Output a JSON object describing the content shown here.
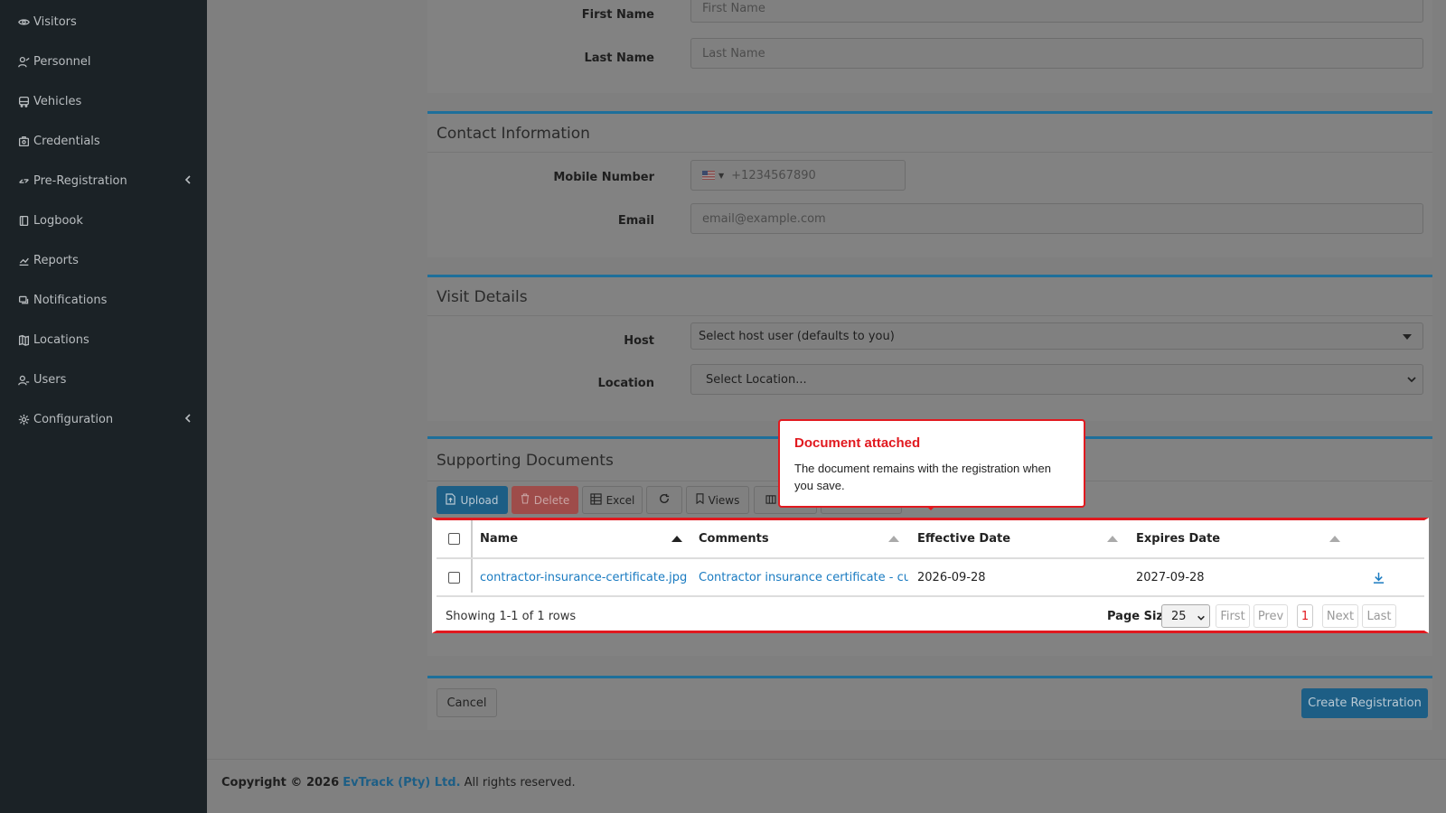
{
  "sidebar": {
    "items": [
      {
        "label": "Visitors",
        "icon": "eye-icon"
      },
      {
        "label": "Personnel",
        "icon": "user-icon"
      },
      {
        "label": "Vehicles",
        "icon": "bus-icon"
      },
      {
        "label": "Credentials",
        "icon": "badge-icon"
      },
      {
        "label": "Pre-Registration",
        "icon": "exchange-icon"
      },
      {
        "label": "Logbook",
        "icon": "book-icon"
      },
      {
        "label": "Reports",
        "icon": "chart-icon"
      },
      {
        "label": "Notifications",
        "icon": "bell-icon"
      },
      {
        "label": "Locations",
        "icon": "map-icon"
      },
      {
        "label": "Users",
        "icon": "users-icon"
      },
      {
        "label": "Configuration",
        "icon": "gear-icon"
      }
    ]
  },
  "personal": {
    "first_name_label": "First Name",
    "first_name_placeholder": "First Name",
    "last_name_label": "Last Name",
    "last_name_placeholder": "Last Name"
  },
  "contact": {
    "heading": "Contact Information",
    "mobile_label": "Mobile Number",
    "mobile_placeholder": "+1234567890",
    "email_label": "Email",
    "email_placeholder": "email@example.com"
  },
  "visit": {
    "heading": "Visit Details",
    "host_label": "Host",
    "host_value": "Select host user (defaults to you)",
    "location_label": "Location",
    "location_value": "Select Location..."
  },
  "documents": {
    "heading": "Supporting Documents",
    "toolbar": {
      "upload": "Upload",
      "delete": "Delete",
      "excel": "Excel",
      "views": "Views"
    },
    "columns": [
      "Name",
      "Comments",
      "Effective Date",
      "Expires Date"
    ],
    "rows": [
      {
        "name": "contractor-insurance-certificate.jpg",
        "comments": "Contractor insurance certificate - cur…",
        "effective": "2026-09-28",
        "expires": "2027-09-28"
      }
    ],
    "summary": "Showing 1-1 of 1 rows",
    "page_size_label": "Page Size",
    "page_size": "25",
    "pager": {
      "first": "First",
      "prev": "Prev",
      "current": "1",
      "next": "Next",
      "last": "Last"
    }
  },
  "popover": {
    "title": "Document attached",
    "body": "The document remains with the registration when you save."
  },
  "actions": {
    "cancel": "Cancel",
    "create": "Create Registration"
  },
  "footer": {
    "prefix": "Copyright © 2026",
    "company": "EvTrack (Pty) Ltd.",
    "suffix": "All rights reserved."
  },
  "colors": {
    "accent": "#1e6f9a",
    "danger": "#e1191f",
    "link": "#1a7bc1",
    "sidebar_bg": "#1b2226"
  }
}
